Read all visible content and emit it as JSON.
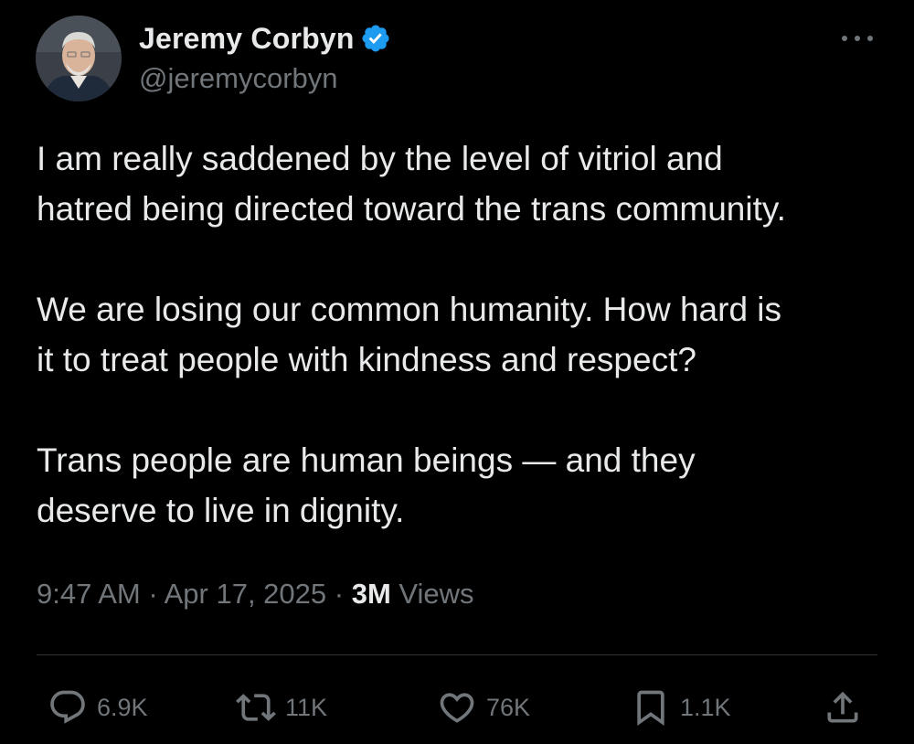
{
  "author": {
    "display_name": "Jeremy Corbyn",
    "handle": "@jeremycorbyn",
    "verified": true,
    "verified_color": "#1d9bf0"
  },
  "tweet": {
    "paragraphs": [
      "I am really saddened by the level of vitriol and\nhatred being directed toward the trans community.",
      "We are losing our common humanity. How hard is\nit to treat people with kindness and respect?",
      "Trans people are human beings — and they\ndeserve to live in dignity."
    ],
    "time": "9:47 AM",
    "date": "Apr 17, 2025",
    "separator": "·",
    "views_count": "3M",
    "views_label": "Views"
  },
  "actions": {
    "replies": {
      "icon": "reply-icon",
      "count": "6.9K"
    },
    "reposts": {
      "icon": "repost-icon",
      "count": "11K"
    },
    "likes": {
      "icon": "heart-icon",
      "count": "76K"
    },
    "bookmarks": {
      "icon": "bookmark-icon",
      "count": "1.1K"
    },
    "share": {
      "icon": "share-icon"
    }
  },
  "colors": {
    "background": "#000000",
    "primary_text": "#e7e9ea",
    "secondary_text": "#71767b",
    "divider": "#2f3336"
  }
}
